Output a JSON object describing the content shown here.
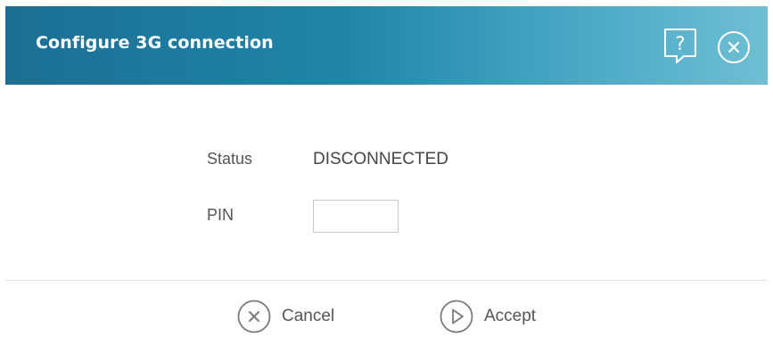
{
  "dialog": {
    "title": "Configure 3G connection",
    "help_icon": "help-icon",
    "close_icon": "close-icon"
  },
  "form": {
    "status_label": "Status",
    "status_value": "DISCONNECTED",
    "pin_label": "PIN",
    "pin_value": "",
    "pin_placeholder": ""
  },
  "footer": {
    "cancel_label": "Cancel",
    "cancel_icon": "cancel-circle-icon",
    "accept_label": "Accept",
    "accept_icon": "play-circle-icon"
  },
  "colors": {
    "header_start": "#1c6f93",
    "header_end": "#6fbfd4",
    "text": "#555555",
    "icon": "#7a7a7a"
  }
}
